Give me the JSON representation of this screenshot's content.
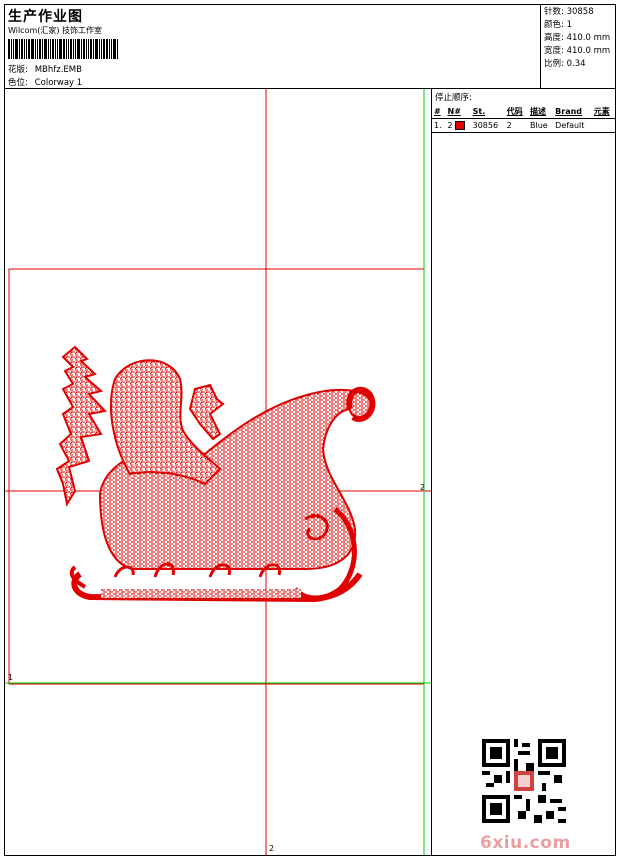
{
  "header": {
    "title": "生产作业图",
    "company": "Wilcom(汇家) 技饰工作室",
    "design_key": "花版:",
    "design_value": "MBhfz.EMB",
    "colorway_key": "色位:",
    "colorway_value": "Colorway 1"
  },
  "stats": [
    {
      "key": "针数:",
      "value": "30858"
    },
    {
      "key": "颜色:",
      "value": "1"
    },
    {
      "key": "高度:",
      "value": "410.0 mm"
    },
    {
      "key": "宽度:",
      "value": "410.0 mm"
    },
    {
      "key": "比例:",
      "value": "0.34"
    }
  ],
  "stop_sequence": {
    "title": "停止顺序:",
    "columns": [
      "#",
      "N#",
      "St.",
      "代码",
      "描述",
      "Brand",
      "元素"
    ],
    "rows": [
      {
        "num": "1.",
        "n": "2",
        "color": "#e00000",
        "stitches": "30856",
        "code": "2",
        "desc": "Blue",
        "brand": "Default",
        "element": ""
      }
    ]
  },
  "canvas": {
    "marker_top_right": "2",
    "marker_bottom": "2",
    "marker_left": "1",
    "stitch_color": "#e00000",
    "guide_red": "#e00000",
    "guide_green": "#00cc00"
  },
  "watermark": "6xiu.com"
}
